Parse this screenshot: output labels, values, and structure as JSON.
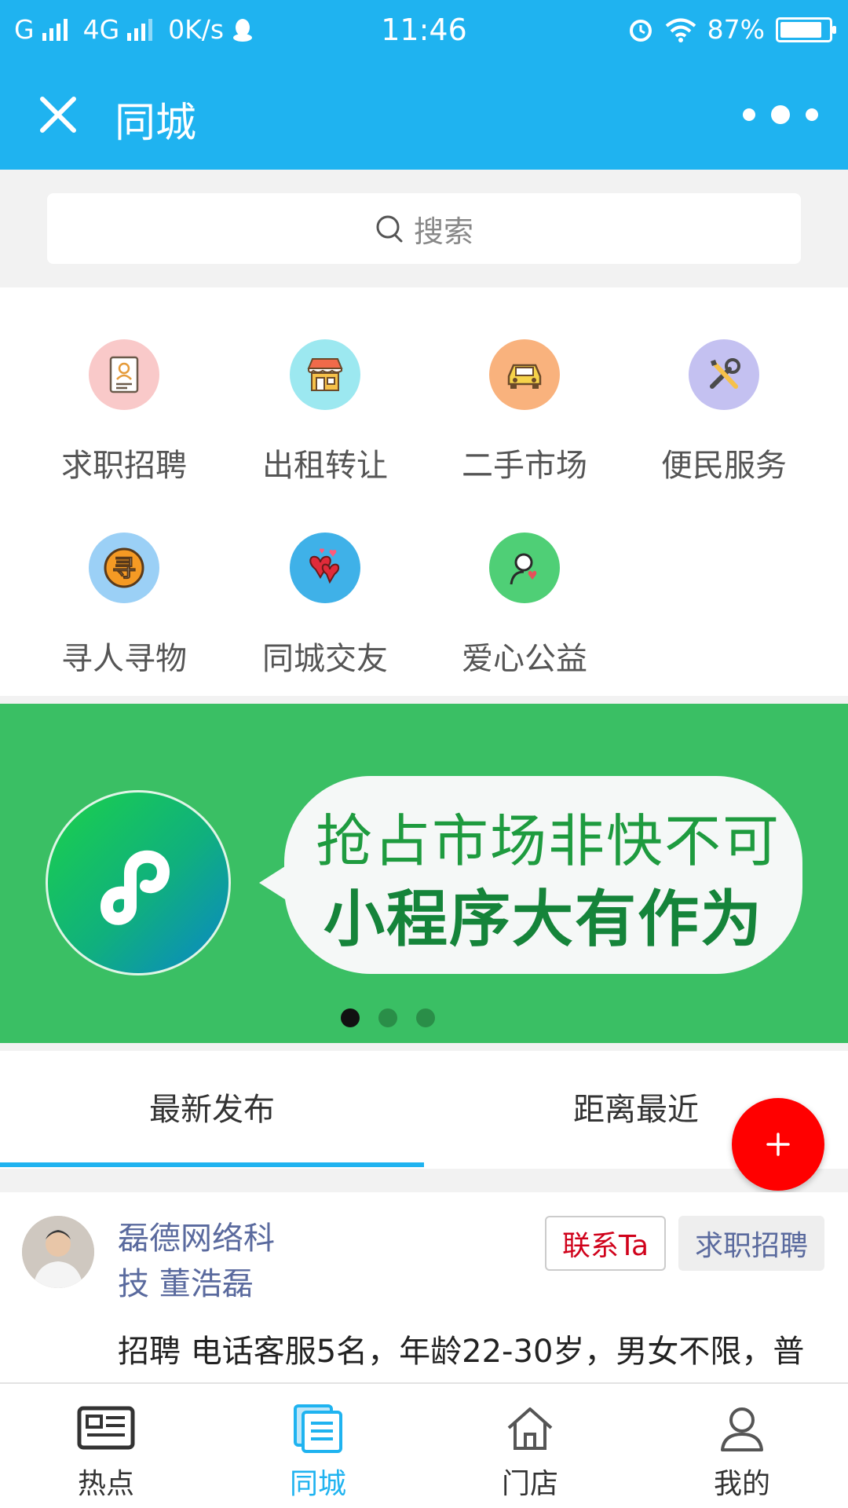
{
  "status_bar": {
    "carrier": "G",
    "network": "4G",
    "speed": "0K/s",
    "time": "11:46",
    "battery": "87%",
    "battery_level": 0.87
  },
  "header": {
    "title": "同城",
    "close_icon": "close-icon",
    "more_icon": "more-dots-icon"
  },
  "search": {
    "placeholder": "搜索"
  },
  "categories": [
    {
      "label": "求职招聘",
      "icon": "resume-icon",
      "color": "#f9c9c9"
    },
    {
      "label": "出租转让",
      "icon": "storefront-icon",
      "color": "#9ce8f0"
    },
    {
      "label": "二手市场",
      "icon": "car-icon",
      "color": "#f9b27d"
    },
    {
      "label": "便民服务",
      "icon": "tools-icon",
      "color": "#c4c1f1"
    },
    {
      "label": "寻人寻物",
      "icon": "search-person-icon",
      "color": "#9bd0f6"
    },
    {
      "label": "同城交友",
      "icon": "hearts-icon",
      "color": "#3fb1e8"
    },
    {
      "label": "爱心公益",
      "icon": "charity-icon",
      "color": "#4fcf76"
    }
  ],
  "banner": {
    "line1": "抢占市场非快不可",
    "line2": "小程序大有作为",
    "slide_count": 3,
    "active_slide": 1
  },
  "tabs": [
    {
      "label": "最新发布",
      "active": true
    },
    {
      "label": "距离最近",
      "active": false
    }
  ],
  "fab": {
    "icon": "plus-icon"
  },
  "post": {
    "author_line1": "磊德网络科",
    "author_line2": "技 董浩磊",
    "contact_label": "联系Ta",
    "category_tag": "求职招聘",
    "text": "招聘 电话客服5名，年龄22-30岁，男女不限，普"
  },
  "bottom_nav": [
    {
      "label": "热点",
      "icon": "news-icon",
      "active": false
    },
    {
      "label": "同城",
      "icon": "list-icon",
      "active": true
    },
    {
      "label": "门店",
      "icon": "home-icon",
      "active": false
    },
    {
      "label": "我的",
      "icon": "user-icon",
      "active": false
    }
  ],
  "colors": {
    "primary": "#1fb3f0",
    "banner_bg": "#3abf64",
    "fab": "#ff0000",
    "link": "#5a6a9e",
    "contact": "#d0021b"
  }
}
